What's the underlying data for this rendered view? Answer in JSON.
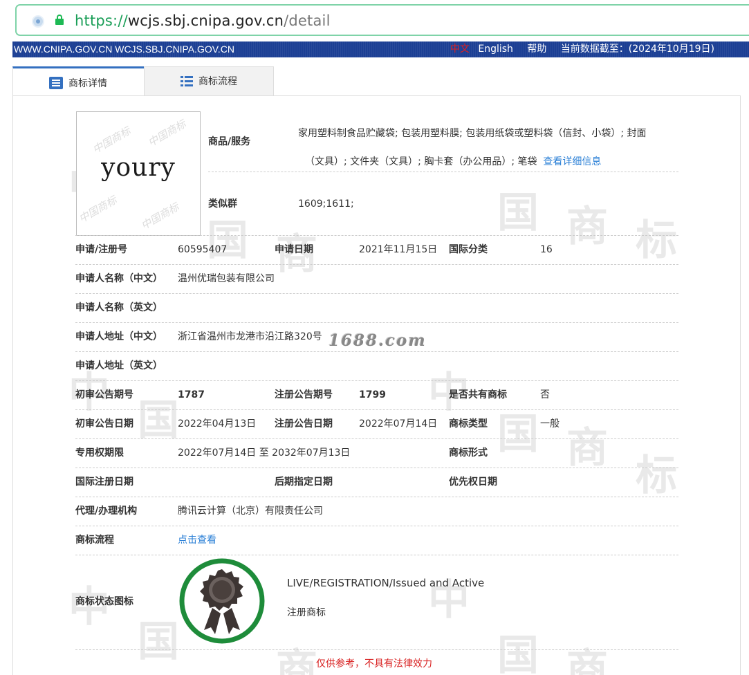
{
  "browser": {
    "url_scheme": "https://",
    "url_host": "wcjs.sbj.cnipa.gov.cn",
    "url_path": "/detail"
  },
  "topbar": {
    "site_text": "WWW.CNIPA.GOV.CN WCJS.SBJ.CNIPA.GOV.CN",
    "lang_zh": "中文",
    "lang_en": "English",
    "help": "帮助",
    "data_date": "当前数据截至：(2024年10月19日)"
  },
  "tabs": {
    "detail": "商标详情",
    "flow": "商标流程"
  },
  "trademark": {
    "image_text": "youry",
    "goods_label": "商品/服务",
    "goods_line1": "家用塑料制食品贮藏袋; 包装用塑料膜; 包装用纸袋或塑料袋（信封、小袋）; 封面",
    "goods_line2": "（文具）; 文件夹（文具）; 胸卡套（办公用品）; 笔袋",
    "goods_more": "查看详细信息",
    "similar_label": "类似群",
    "similar_value": "1609;1611;"
  },
  "fields": {
    "reg_no_label": "申请/注册号",
    "reg_no": "60595407",
    "apply_date_label": "申请日期",
    "apply_date": "2021年11月15日",
    "intl_class_label": "国际分类",
    "intl_class": "16",
    "applicant_cn_label": "申请人名称（中文）",
    "applicant_cn": "温州优瑞包装有限公司",
    "applicant_en_label": "申请人名称（英文）",
    "applicant_en": "",
    "address_cn_label": "申请人地址（中文）",
    "address_cn": "浙江省温州市龙港市沿江路320号",
    "address_en_label": "申请人地址（英文）",
    "address_en": "",
    "prelim_no_label": "初审公告期号",
    "prelim_no": "1787",
    "reg_pub_no_label": "注册公告期号",
    "reg_pub_no": "1799",
    "shared_label": "是否共有商标",
    "shared": "否",
    "prelim_date_label": "初审公告日期",
    "prelim_date": "2022年04月13日",
    "reg_pub_date_label": "注册公告日期",
    "reg_pub_date": "2022年07月14日",
    "tm_type_label": "商标类型",
    "tm_type": "一般",
    "exclusive_label": "专用权期限",
    "exclusive": "2022年07月14日 至 2032年07月13日",
    "tm_form_label": "商标形式",
    "tm_form": "",
    "intl_reg_date_label": "国际注册日期",
    "later_date_label": "后期指定日期",
    "priority_date_label": "优先权日期",
    "agent_label": "代理/办理机构",
    "agent": "腾讯云计算（北京）有限责任公司",
    "flow_label": "商标流程",
    "flow_link": "点击查看",
    "status_label": "商标状态图标",
    "status_en": "LIVE/REGISTRATION/Issued and Active",
    "status_zh": "注册商标"
  },
  "overlay_watermark": "1688.com",
  "disclaimer": "仅供参考，不具有法律效力",
  "colors": {
    "topbar": "#1c3f94",
    "accent": "#3470c0",
    "link": "#2a7fd6",
    "seal_ring": "#1e8c3a",
    "disclaimer": "#d82020"
  }
}
